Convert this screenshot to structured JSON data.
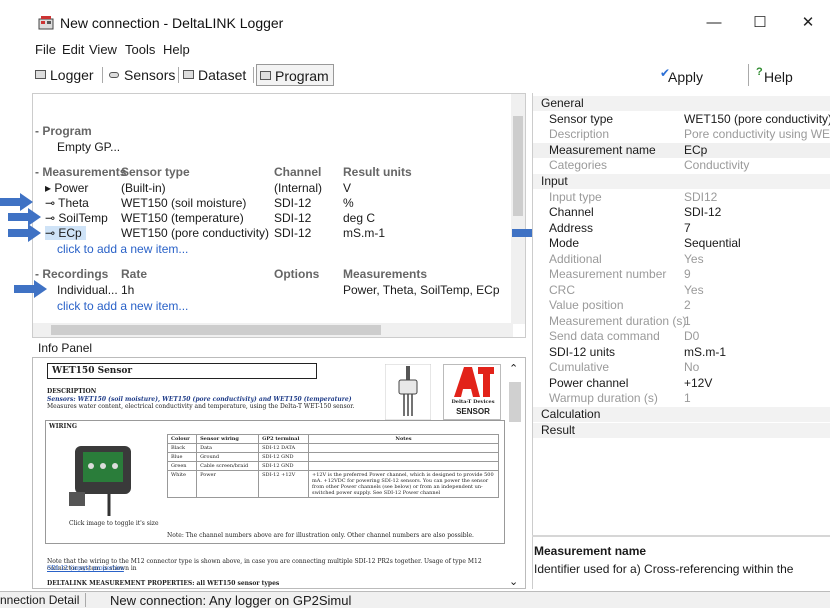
{
  "window": {
    "title": "New connection - DeltaLINK Logger",
    "minimize": "—",
    "maximize": "☐",
    "close": "✕"
  },
  "menu": [
    "File",
    "Edit",
    "View",
    "Tools",
    "Help"
  ],
  "toolbar": {
    "tabs": [
      "Logger",
      "Sensors",
      "Dataset",
      "Program"
    ],
    "active_tab": "Program",
    "apply_label": "Apply",
    "help_label": "Help"
  },
  "program": {
    "program_header": "Program",
    "program_value": "Empty GP...",
    "measurements_header": "Measurements",
    "columns": {
      "sensor_type": "Sensor type",
      "channel": "Channel",
      "result_units": "Result units"
    },
    "rows": [
      {
        "name": "Power",
        "sensor": "(Built-in)",
        "channel": "(Internal)",
        "units": "V"
      },
      {
        "name": "Theta",
        "sensor": "WET150 (soil moisture)",
        "channel": "SDI-12",
        "units": "%"
      },
      {
        "name": "SoilTemp",
        "sensor": "WET150 (temperature)",
        "channel": "SDI-12",
        "units": "deg C"
      },
      {
        "name": "ECp",
        "sensor": "WET150 (pore conductivity)",
        "channel": "SDI-12",
        "units": "mS.m-1"
      }
    ],
    "add_item_1": "click to add a new item...",
    "recordings_header": "Recordings",
    "rec_columns": {
      "rate": "Rate",
      "options": "Options",
      "measurements": "Measurements"
    },
    "recording": {
      "name": "Individual...",
      "rate": "1h",
      "measurements": "Power, Theta, SoilTemp, ECp"
    },
    "add_item_2": "click to add a new item..."
  },
  "info_panel": {
    "label": "Info Panel",
    "doc_title": "WET150 Sensor",
    "description_heading": "DESCRIPTION",
    "description_line1": "Sensors: WET150 (soil moisture), WET150 (pore conductivity) and WET150 (temperature)",
    "description_line2": "Measures water content, electrical conductivity and temperature, using the Delta-T WET-150 sensor.",
    "wiring_heading": "WIRING",
    "image_caption": "Click image to toggle it's size",
    "logo_line1": "Delta-T Devices",
    "logo_line2": "SENSOR",
    "table_headers": [
      "Colour",
      "Sensor wiring",
      "GP2 terminal",
      "Notes"
    ],
    "table_rows": [
      [
        "Black",
        "Data",
        "SDI-12 DATA",
        ""
      ],
      [
        "Blue",
        "Ground",
        "SDI-12 GND",
        ""
      ],
      [
        "Green",
        "Cable screen/braid",
        "SDI-12 GND",
        ""
      ],
      [
        "White",
        "Power",
        "SDI-12 +12V",
        "+12V is the preferred Power channel, which is designed to provide 500 mA. +12VDC for powering SDI-12 sensors. You can power the sensor from other Power channels (see below) or from an independent un-switched power supply. See SDI-12 Power channel"
      ]
    ],
    "table_note": "Note: The channel numbers above are for illustration only. Other channel numbers are also possible.",
    "m12_note": "Note that the wiring to the M12 connector type is shown above, in case you are connecting multiple SDI-12 PR2s together. Usage of type M12 connector system is shown in",
    "m12_link": "SDI-12 (input) properties",
    "props_heading": "DELTALINK MEASUREMENT PROPERTIES: all WET150 sensor types"
  },
  "properties": {
    "categories": {
      "general": "General",
      "input": "Input",
      "calculation": "Calculation",
      "result": "Result"
    },
    "general": [
      {
        "k": "Sensor type",
        "v": "WET150 (pore conductivity)",
        "dim": false
      },
      {
        "k": "Description",
        "v": "Pore conductivity using WE...",
        "dim": true
      },
      {
        "k": "Measurement name",
        "v": "ECp",
        "dim": false
      },
      {
        "k": "Categories",
        "v": "Conductivity",
        "dim": true
      }
    ],
    "input": [
      {
        "k": "Input type",
        "v": "SDI12",
        "dim": true
      },
      {
        "k": "Channel",
        "v": "SDI-12",
        "dim": false
      },
      {
        "k": "Address",
        "v": "7",
        "dim": false
      },
      {
        "k": "Mode",
        "v": "Sequential",
        "dim": false
      },
      {
        "k": "Additional",
        "v": "Yes",
        "dim": true
      },
      {
        "k": "Measurement number",
        "v": "9",
        "dim": true
      },
      {
        "k": "CRC",
        "v": "Yes",
        "dim": true
      },
      {
        "k": "Value position",
        "v": "2",
        "dim": true
      },
      {
        "k": "Measurement duration (s)",
        "v": "1",
        "dim": true
      },
      {
        "k": "Send data command",
        "v": "D0",
        "dim": true
      },
      {
        "k": "SDI-12 units",
        "v": "mS.m-1",
        "dim": false
      },
      {
        "k": "Cumulative",
        "v": "No",
        "dim": true
      },
      {
        "k": "Power channel",
        "v": "+12V",
        "dim": false
      },
      {
        "k": "Warmup duration (s)",
        "v": "1",
        "dim": true
      }
    ],
    "hint_title": "Measurement name",
    "hint_desc": "Identifier used for a) Cross-referencing within the"
  },
  "status": {
    "left": "nnection Detail",
    "right": "New connection: Any logger on GP2Simul"
  },
  "colors": {
    "arrow": "#3f72c4",
    "link": "#2a62c8",
    "selection": "#cfe3f7",
    "logo_red": "#e2231a"
  }
}
